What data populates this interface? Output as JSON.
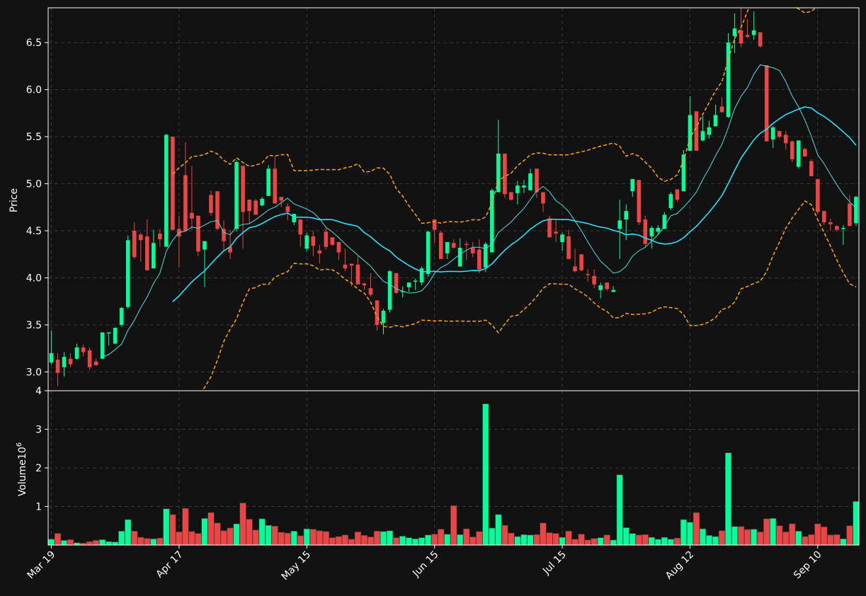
{
  "colors": {
    "background": "#121212",
    "up": "#00ff99",
    "down": "#ef4444",
    "ma_fast": "#4ddddd",
    "ma_slow": "#1fe5ff",
    "bollinger": "#ffa500",
    "grid": "#3a3a3a",
    "axis": "#ffffff"
  },
  "chart_data": [
    {
      "type": "candlestick",
      "ylabel": "Price",
      "ylim": [
        2.8,
        6.87
      ],
      "grid": true,
      "yticks": [
        "3.0",
        "3.5",
        "4.0",
        "4.5",
        "5.0",
        "5.5",
        "6.0",
        "6.5"
      ],
      "x_tick_labels": [
        "Mar 19",
        "Apr 17",
        "May 15",
        "Jun 15",
        "Jul 15",
        "Aug 12",
        "Sep 10"
      ],
      "x_tick_indices": [
        0,
        20,
        40,
        60,
        80,
        100,
        120
      ],
      "ohlc": [
        [
          3.1,
          3.44,
          3.08,
          3.2
        ],
        [
          3.13,
          3.2,
          2.85,
          2.99
        ],
        [
          3.05,
          3.21,
          2.95,
          3.16
        ],
        [
          3.14,
          3.2,
          3.05,
          3.08
        ],
        [
          3.14,
          3.3,
          3.13,
          3.26
        ],
        [
          3.26,
          3.29,
          3.16,
          3.21
        ],
        [
          3.23,
          3.26,
          3.02,
          3.05
        ],
        [
          3.11,
          3.14,
          3.07,
          3.07
        ],
        [
          3.14,
          3.26,
          3.14,
          3.42
        ],
        [
          3.42,
          3.42,
          3.28,
          3.42
        ],
        [
          3.3,
          3.46,
          3.3,
          3.47
        ],
        [
          3.5,
          3.69,
          3.48,
          3.68
        ],
        [
          3.69,
          4.45,
          3.67,
          4.4
        ],
        [
          4.5,
          4.59,
          4.2,
          4.22
        ],
        [
          4.46,
          4.48,
          4.17,
          4.4
        ],
        [
          4.44,
          4.62,
          4.08,
          4.08
        ],
        [
          4.1,
          4.51,
          4.1,
          4.37
        ],
        [
          4.47,
          4.52,
          4.33,
          4.41
        ],
        [
          4.33,
          5.53,
          4.33,
          5.52
        ],
        [
          5.5,
          5.5,
          4.51,
          4.51
        ],
        [
          4.52,
          4.66,
          4.11,
          4.44
        ],
        [
          5.09,
          5.44,
          4.5,
          4.5
        ],
        [
          4.69,
          5.19,
          4.51,
          4.63
        ],
        [
          4.66,
          4.66,
          4.23,
          4.28
        ],
        [
          4.3,
          4.39,
          3.9,
          4.39
        ],
        [
          4.88,
          4.93,
          4.66,
          4.69
        ],
        [
          4.92,
          4.92,
          4.51,
          4.52
        ],
        [
          4.52,
          4.61,
          4.29,
          4.39
        ],
        [
          4.33,
          4.51,
          4.2,
          4.27
        ],
        [
          4.52,
          5.25,
          4.49,
          5.23
        ],
        [
          5.19,
          5.19,
          4.31,
          4.7
        ],
        [
          4.83,
          4.83,
          4.58,
          4.71
        ],
        [
          4.82,
          4.84,
          4.68,
          4.67
        ],
        [
          4.77,
          4.86,
          4.76,
          4.84
        ],
        [
          4.87,
          5.2,
          4.87,
          5.16
        ],
        [
          5.16,
          5.29,
          4.79,
          4.79
        ],
        [
          4.86,
          4.86,
          4.75,
          4.82
        ],
        [
          4.76,
          4.79,
          4.61,
          4.7
        ],
        [
          4.59,
          4.68,
          4.56,
          4.68
        ],
        [
          4.62,
          4.6,
          4.33,
          4.46
        ],
        [
          4.31,
          4.48,
          4.28,
          4.45
        ],
        [
          4.44,
          4.5,
          4.23,
          4.34
        ],
        [
          4.29,
          4.35,
          4.15,
          4.26
        ],
        [
          4.49,
          4.53,
          4.3,
          4.33
        ],
        [
          4.43,
          4.43,
          4.34,
          4.35
        ],
        [
          4.38,
          4.38,
          4.19,
          4.27
        ],
        [
          4.14,
          4.31,
          4.07,
          4.1
        ],
        [
          4.15,
          4.15,
          3.91,
          4.13
        ],
        [
          4.14,
          4.23,
          3.95,
          3.93
        ],
        [
          3.94,
          3.95,
          3.87,
          3.92
        ],
        [
          3.89,
          4.05,
          3.8,
          3.82
        ],
        [
          3.76,
          3.76,
          3.44,
          3.5
        ],
        [
          3.52,
          3.67,
          3.4,
          3.65
        ],
        [
          3.66,
          4.08,
          3.63,
          4.07
        ],
        [
          4.05,
          4.05,
          3.83,
          3.84
        ],
        [
          3.85,
          3.91,
          3.79,
          3.86
        ],
        [
          3.9,
          3.94,
          3.85,
          3.95
        ],
        [
          3.96,
          3.99,
          3.87,
          3.97
        ],
        [
          3.95,
          4.12,
          3.92,
          4.1
        ],
        [
          4.04,
          4.5,
          4.01,
          4.49
        ],
        [
          4.62,
          4.62,
          4.37,
          4.51
        ],
        [
          4.48,
          4.5,
          4.21,
          4.2
        ],
        [
          4.26,
          4.36,
          4.2,
          4.38
        ],
        [
          4.37,
          4.41,
          4.31,
          4.32
        ],
        [
          4.12,
          4.42,
          4.12,
          4.32
        ],
        [
          4.36,
          4.39,
          4.19,
          4.35
        ],
        [
          4.32,
          4.38,
          4.22,
          4.26
        ],
        [
          4.3,
          4.41,
          4.05,
          4.09
        ],
        [
          4.11,
          4.38,
          4.06,
          4.36
        ],
        [
          4.27,
          4.95,
          4.27,
          4.93
        ],
        [
          4.91,
          5.68,
          4.91,
          5.32
        ],
        [
          5.32,
          5.32,
          4.85,
          4.89
        ],
        [
          4.91,
          4.91,
          4.82,
          4.83
        ],
        [
          4.9,
          5.03,
          4.78,
          4.98
        ],
        [
          4.96,
          5.04,
          4.9,
          4.98
        ],
        [
          4.93,
          5.16,
          4.93,
          5.11
        ],
        [
          5.16,
          5.16,
          4.85,
          4.91
        ],
        [
          4.91,
          4.89,
          4.7,
          4.79
        ],
        [
          4.63,
          4.66,
          4.43,
          4.43
        ],
        [
          4.49,
          4.62,
          4.38,
          4.47
        ],
        [
          4.38,
          4.48,
          4.29,
          4.46
        ],
        [
          4.44,
          4.51,
          4.2,
          4.2
        ],
        [
          4.12,
          4.31,
          4.06,
          4.07
        ],
        [
          4.25,
          4.25,
          4.07,
          4.08
        ],
        [
          4.04,
          4.09,
          3.96,
          4.03
        ],
        [
          4.02,
          4.09,
          3.89,
          3.93
        ],
        [
          3.87,
          3.95,
          3.78,
          3.92
        ],
        [
          3.95,
          3.95,
          3.86,
          3.88
        ],
        [
          3.85,
          3.91,
          3.85,
          3.87
        ],
        [
          4.52,
          4.83,
          4.2,
          4.61
        ],
        [
          4.62,
          4.78,
          4.4,
          4.71
        ],
        [
          4.92,
          5.05,
          4.86,
          5.05
        ],
        [
          5.04,
          5.04,
          4.56,
          4.59
        ],
        [
          4.62,
          4.66,
          4.33,
          4.36
        ],
        [
          4.44,
          4.55,
          4.31,
          4.53
        ],
        [
          4.49,
          4.56,
          4.46,
          4.53
        ],
        [
          4.52,
          4.7,
          4.52,
          4.67
        ],
        [
          4.74,
          4.91,
          4.72,
          4.89
        ],
        [
          4.94,
          4.91,
          4.81,
          4.83
        ],
        [
          4.92,
          5.36,
          4.92,
          5.31
        ],
        [
          5.35,
          5.93,
          5.35,
          5.73
        ],
        [
          5.77,
          5.77,
          5.37,
          5.35
        ],
        [
          5.46,
          5.72,
          5.45,
          5.56
        ],
        [
          5.52,
          5.67,
          5.48,
          5.6
        ],
        [
          5.61,
          5.84,
          5.61,
          5.73
        ],
        [
          5.82,
          5.92,
          5.77,
          5.76
        ],
        [
          5.71,
          6.6,
          5.7,
          6.5
        ],
        [
          6.57,
          6.81,
          6.39,
          6.65
        ],
        [
          6.63,
          6.88,
          6.45,
          6.49
        ],
        [
          6.58,
          6.75,
          6.55,
          6.56
        ],
        [
          6.58,
          6.83,
          6.53,
          6.63
        ],
        [
          6.61,
          6.55,
          6.45,
          6.46
        ],
        [
          6.26,
          6.26,
          5.45,
          5.45
        ],
        [
          5.47,
          5.61,
          5.38,
          5.6
        ],
        [
          5.56,
          5.56,
          5.48,
          5.5
        ],
        [
          5.52,
          5.56,
          5.36,
          5.43
        ],
        [
          5.45,
          5.46,
          5.23,
          5.26
        ],
        [
          5.18,
          5.46,
          5.16,
          5.46
        ],
        [
          5.37,
          5.38,
          5.29,
          5.29
        ],
        [
          5.24,
          5.26,
          5.08,
          5.08
        ],
        [
          5.05,
          5.05,
          4.68,
          4.7
        ],
        [
          4.71,
          4.71,
          4.56,
          4.59
        ],
        [
          4.59,
          4.63,
          4.5,
          4.57
        ],
        [
          4.55,
          4.56,
          4.49,
          4.51
        ],
        [
          4.52,
          4.56,
          4.35,
          4.53
        ],
        [
          4.79,
          4.88,
          4.55,
          4.55
        ],
        [
          4.58,
          4.87,
          4.55,
          4.86
        ]
      ],
      "ma_fast_start": 8,
      "ma_slow_start": 19,
      "bollinger_start": 19
    },
    {
      "type": "bar",
      "ylabel": "Volume",
      "ylabel_exponent": "6",
      "ylabel_base": "10",
      "ylim": [
        0,
        4.0
      ],
      "yticks": [
        "1",
        "2",
        "3",
        "4"
      ],
      "values": [
        0.15,
        0.3,
        0.12,
        0.14,
        0.06,
        0.05,
        0.09,
        0.12,
        0.14,
        0.09,
        0.08,
        0.36,
        0.66,
        0.36,
        0.2,
        0.17,
        0.16,
        0.18,
        0.94,
        0.79,
        0.34,
        0.95,
        0.35,
        0.3,
        0.69,
        0.84,
        0.57,
        0.37,
        0.44,
        0.55,
        1.09,
        0.67,
        0.39,
        0.68,
        0.51,
        0.49,
        0.33,
        0.31,
        0.36,
        0.24,
        0.42,
        0.41,
        0.37,
        0.35,
        0.19,
        0.22,
        0.26,
        0.15,
        0.34,
        0.25,
        0.21,
        0.36,
        0.35,
        0.37,
        0.19,
        0.23,
        0.19,
        0.16,
        0.19,
        0.26,
        0.28,
        0.41,
        0.28,
        1.02,
        0.27,
        0.42,
        0.21,
        0.35,
        3.66,
        0.44,
        0.79,
        0.51,
        0.31,
        0.22,
        0.27,
        0.26,
        0.27,
        0.57,
        0.32,
        0.3,
        0.2,
        0.36,
        0.15,
        0.28,
        0.13,
        0.17,
        0.19,
        0.26,
        0.13,
        1.82,
        0.45,
        0.3,
        0.26,
        0.27,
        0.2,
        0.15,
        0.2,
        0.15,
        0.18,
        0.66,
        0.59,
        0.84,
        0.42,
        0.25,
        0.22,
        0.37,
        2.39,
        0.48,
        0.48,
        0.4,
        0.41,
        0.34,
        0.68,
        0.69,
        0.5,
        0.34,
        0.55,
        0.36,
        0.22,
        0.27,
        0.55,
        0.47,
        0.26,
        0.27,
        0.16,
        0.5,
        1.13
      ]
    }
  ]
}
